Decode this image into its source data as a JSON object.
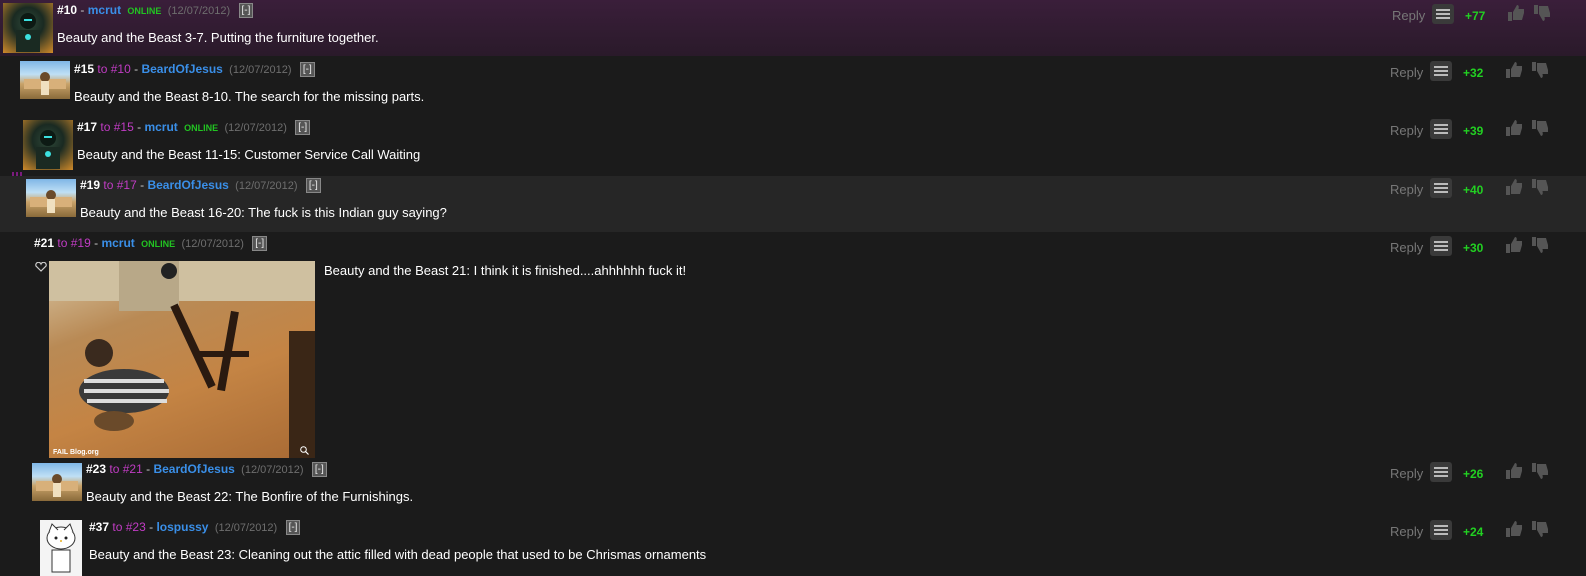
{
  "ui": {
    "reply_label": "Reply",
    "online_label": "ONLINE",
    "to_label": "to",
    "collapse_label": "[-]",
    "colors": {
      "username": "#3a8fe8",
      "online": "#22c322",
      "reply_ref": "#c13cc4",
      "score": "#22d022",
      "thread_line": "#8b1e8e"
    }
  },
  "comments": [
    {
      "num": "#10",
      "to": "",
      "user": "mcrut",
      "online": true,
      "date": "(12/07/2012)",
      "text": "Beauty and the Beast 3-7. Putting the furniture together.",
      "score": "+77",
      "avatar": "armored-figure-avatar"
    },
    {
      "num": "#15",
      "to": "#10",
      "user": "BeardOfJesus",
      "online": false,
      "date": "(12/07/2012)",
      "text": "Beauty and the Beast 8-10. The search for the missing parts.",
      "score": "+32",
      "avatar": "beach-scene-avatar"
    },
    {
      "num": "#17",
      "to": "#15",
      "user": "mcrut",
      "online": true,
      "date": "(12/07/2012)",
      "text": "Beauty and the Beast 11-15: Customer Service Call Waiting",
      "score": "+39",
      "avatar": "armored-figure-avatar"
    },
    {
      "num": "#19",
      "to": "#17",
      "user": "BeardOfJesus",
      "online": false,
      "date": "(12/07/2012)",
      "text": "Beauty and the Beast 16-20: The fuck is this Indian guy saying?",
      "score": "+40",
      "avatar": "beach-scene-avatar"
    },
    {
      "num": "#21",
      "to": "#19",
      "user": "mcrut",
      "online": true,
      "date": "(12/07/2012)",
      "text": "Beauty and the Beast 21: I think it is finished....ahhhhhh fuck it!",
      "score": "+30",
      "image_caption": "FAIL Blog.org"
    },
    {
      "num": "#23",
      "to": "#21",
      "user": "BeardOfJesus",
      "online": false,
      "date": "(12/07/2012)",
      "text": "Beauty and the Beast 22: The Bonfire of the Furnishings.",
      "score": "+26",
      "avatar": "beach-scene-avatar"
    },
    {
      "num": "#37",
      "to": "#23",
      "user": "lospussy",
      "online": false,
      "date": "(12/07/2012)",
      "text": "Beauty and the Beast 23: Cleaning out the attic filled with dead people that used to be Chrismas ornaments",
      "score": "+24",
      "avatar": "cat-character-avatar"
    }
  ]
}
